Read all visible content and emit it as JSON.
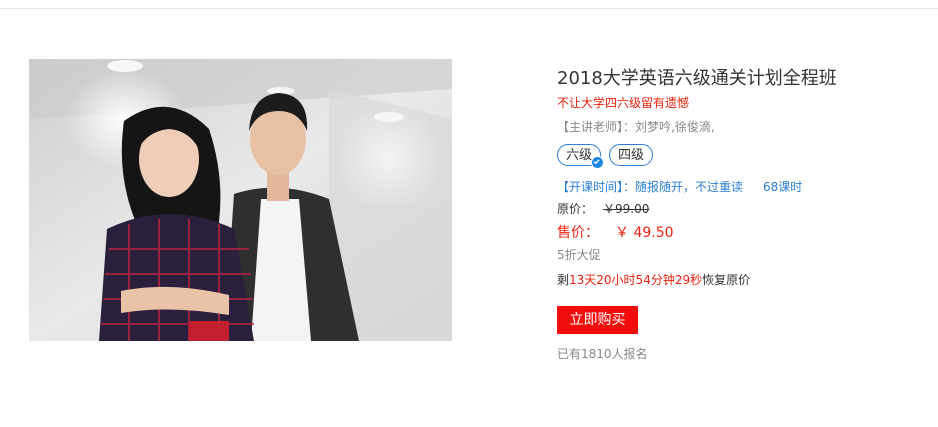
{
  "course": {
    "title": "2018大学英语六级通关计划全程班",
    "subtitle": "不让大学四六级留有遗憾",
    "teachers_label": "【主讲老师】：",
    "teachers": "刘梦吟,徐俊滴,",
    "tags": [
      {
        "label": "六级",
        "selected": true
      },
      {
        "label": "四级",
        "selected": false
      }
    ],
    "schedule_label": "【开课时间】：",
    "schedule_text": "随报随开，不过重读",
    "hours": "68课时",
    "original_price_label": "原价：",
    "original_price": "￥99.00",
    "sale_price_label": "售价：",
    "sale_price": "￥ 49.50",
    "discount": "5折大促",
    "countdown_prefix": "剩",
    "countdown_time": "13天20小时54分钟29秒",
    "countdown_suffix": "恢复原价",
    "buy_label": "立即购买",
    "enrolled": "已有1810人报名"
  },
  "colors": {
    "accent_red": "#e8220e",
    "button_red": "#f20d0d",
    "link_blue": "#2b7fd4"
  }
}
